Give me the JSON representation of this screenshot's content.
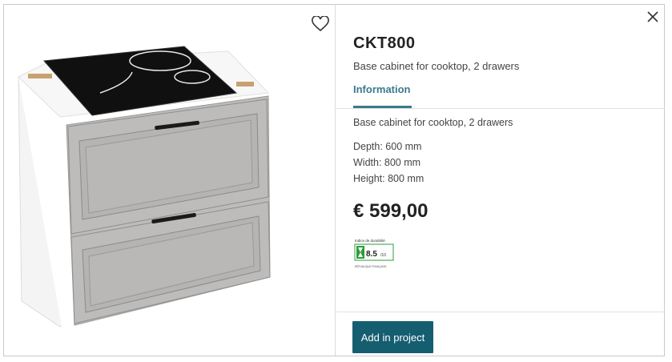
{
  "product": {
    "code": "CKT800",
    "subtitle": "Base cabinet for cooktop, 2 drawers",
    "description": "Base cabinet for cooktop, 2 drawers",
    "depth": "Depth: 600 mm",
    "width": "Width: 800 mm",
    "height": "Height: 800 mm",
    "price": "€ 599,00"
  },
  "tabs": {
    "information": "Information"
  },
  "durability": {
    "header": "Indice de durabilité",
    "score": "8.5",
    "scale": "/10",
    "footer": "RÉPUBLIQUE FRANÇAISE",
    "color": "#2e9c3a"
  },
  "actions": {
    "add_in_project": "Add in project"
  },
  "icons": {
    "favorite": "heart-icon",
    "close": "close-icon"
  },
  "colors": {
    "accent": "#3a7a8c",
    "button": "#155e70"
  }
}
